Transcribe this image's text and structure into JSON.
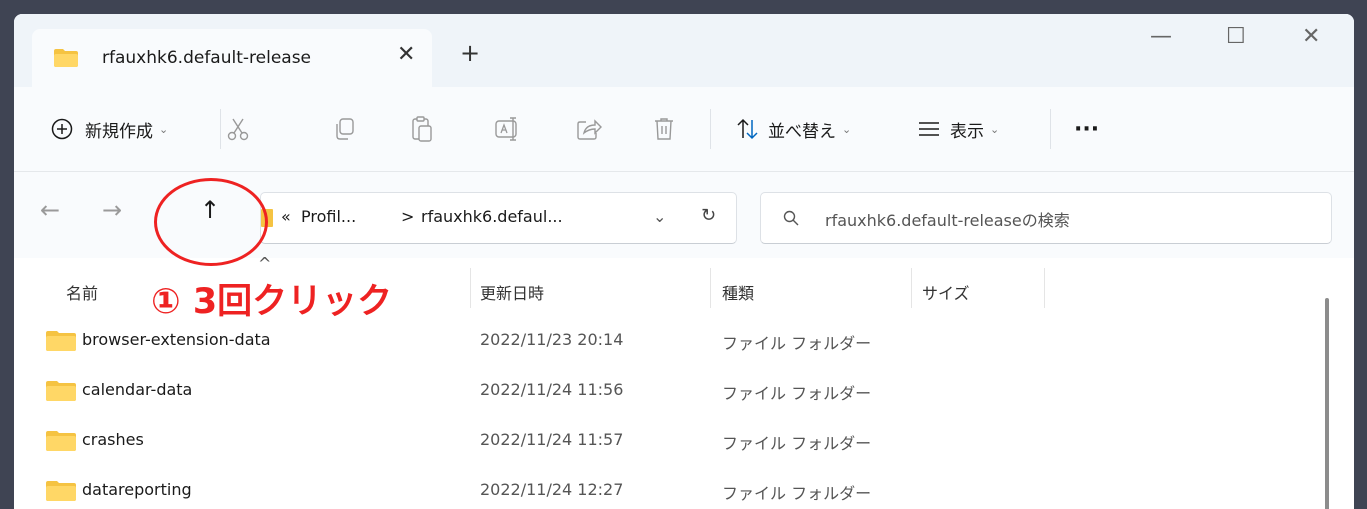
{
  "window": {
    "tab_title": "rfauxhk6.default-release",
    "close_tab": "✕",
    "new_tab": "+",
    "controls": {
      "minimize": "—",
      "maximize": "☐",
      "close": "✕"
    }
  },
  "toolbar": {
    "new_label": "新規作成",
    "sort_label": "並べ替え",
    "view_label": "表示",
    "more": "···",
    "icons": [
      "cut-icon",
      "copy-icon",
      "paste-icon",
      "rename-icon",
      "share-icon",
      "delete-icon"
    ]
  },
  "nav": {
    "back": "←",
    "forward": "→",
    "up": "↑",
    "address": {
      "overflow": "«",
      "crumb1": "Profil...",
      "separator": ">",
      "crumb2": "rfauxhk6.defaul..."
    },
    "dropdown": "⌄",
    "refresh": "↻",
    "search_placeholder": "rfauxhk6.default-releaseの検索"
  },
  "list": {
    "columns": {
      "name": "名前",
      "date": "更新日時",
      "type": "種類",
      "size": "サイズ"
    },
    "rows": [
      {
        "name": "browser-extension-data",
        "date": "2022/11/23 20:14",
        "type": "ファイル フォルダー"
      },
      {
        "name": "calendar-data",
        "date": "2022/11/24 11:56",
        "type": "ファイル フォルダー"
      },
      {
        "name": "crashes",
        "date": "2022/11/24 11:57",
        "type": "ファイル フォルダー"
      },
      {
        "name": "datareporting",
        "date": "2022/11/24 12:27",
        "type": "ファイル フォルダー"
      }
    ]
  },
  "annotation": {
    "text": "① 3回クリック"
  },
  "colors": {
    "annotation": "#ee2222",
    "folder": "#f5c342",
    "accent": "#0067c0"
  }
}
